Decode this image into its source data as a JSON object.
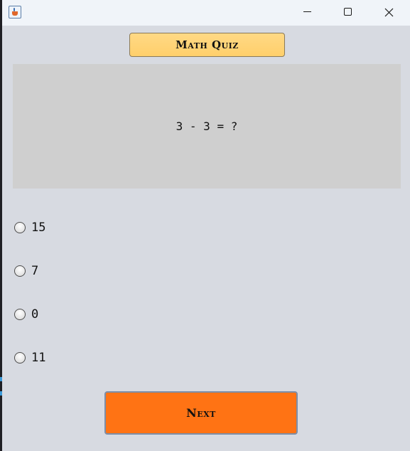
{
  "window": {
    "icon": "java-cup-icon",
    "controls": {
      "minimize_icon": "minimize-icon",
      "maximize_icon": "maximize-icon",
      "close_icon": "close-icon"
    }
  },
  "quiz": {
    "title": "Math Quiz",
    "question": "3 - 3 = ?",
    "options": [
      {
        "label": "15",
        "selected": false
      },
      {
        "label": "7",
        "selected": false
      },
      {
        "label": "0",
        "selected": false
      },
      {
        "label": "11",
        "selected": false
      }
    ],
    "next_label": "Next"
  },
  "colors": {
    "title_button": "#ffd27a",
    "next_button": "#ff7314",
    "question_panel": "#cfcfcf",
    "window_background": "#d7dae1"
  }
}
